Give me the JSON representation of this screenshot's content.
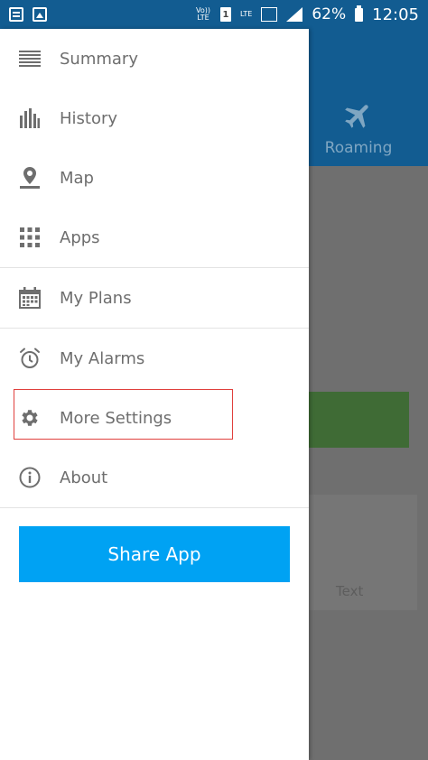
{
  "status_bar": {
    "volte": "Vo)) LTE",
    "sim": "1",
    "lte": "LTE",
    "battery_percent": "62%",
    "time": "12:05"
  },
  "background": {
    "roaming_label": "Roaming",
    "card_text": "Text"
  },
  "drawer": {
    "items": [
      {
        "label": "Summary",
        "icon": "list-icon"
      },
      {
        "label": "History",
        "icon": "bar-chart-icon"
      },
      {
        "label": "Map",
        "icon": "map-pin-icon"
      },
      {
        "label": "Apps",
        "icon": "grid-icon"
      },
      {
        "label": "My Plans",
        "icon": "calendar-icon"
      },
      {
        "label": "My Alarms",
        "icon": "alarm-clock-icon"
      },
      {
        "label": "More Settings",
        "icon": "gear-icon"
      },
      {
        "label": "About",
        "icon": "info-icon"
      }
    ],
    "share_button": "Share App"
  },
  "colors": {
    "header_blue": "#125c91",
    "share_blue": "#00a2f3",
    "highlight_red": "#e0403d",
    "icon_gray": "#6e6e6e"
  }
}
